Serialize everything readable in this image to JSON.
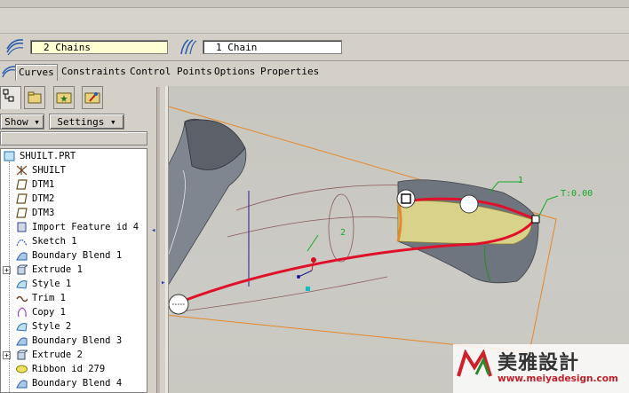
{
  "dashboard": {
    "chain_field_1": "2 Chains",
    "chain_field_2": "1 Chain"
  },
  "tabs": [
    "Curves",
    "Constraints",
    "Control Points",
    "Options",
    "Properties"
  ],
  "panel": {
    "show_label": "Show",
    "settings_label": "Settings"
  },
  "tree": [
    {
      "label": "SHUILT.PRT",
      "icon": "part-icon"
    },
    {
      "label": "SHUILT",
      "icon": "axes-icon"
    },
    {
      "label": "DTM1",
      "icon": "datum-plane-icon"
    },
    {
      "label": "DTM2",
      "icon": "datum-plane-icon"
    },
    {
      "label": "DTM3",
      "icon": "datum-plane-icon"
    },
    {
      "label": "Import Feature id 4",
      "icon": "import-icon"
    },
    {
      "label": "Sketch 1",
      "icon": "sketch-icon"
    },
    {
      "label": "Boundary Blend 1",
      "icon": "boundary-blend-icon"
    },
    {
      "label": "Extrude 1",
      "icon": "extrude-icon"
    },
    {
      "label": "Style 1",
      "icon": "style-icon"
    },
    {
      "label": "Trim 1",
      "icon": "trim-icon"
    },
    {
      "label": "Copy 1",
      "icon": "copy-icon"
    },
    {
      "label": "Style 2",
      "icon": "style-icon"
    },
    {
      "label": "Boundary Blend 3",
      "icon": "boundary-blend-icon"
    },
    {
      "label": "Extrude 2",
      "icon": "extrude-icon"
    },
    {
      "label": "Ribbon id 279",
      "icon": "ribbon-icon"
    },
    {
      "label": "Boundary Blend 4",
      "icon": "boundary-blend-icon"
    }
  ],
  "viewport": {
    "label_1": "1",
    "label_2": "2",
    "tension_label": "T:0.00"
  },
  "watermark": {
    "brand": "美雅設計",
    "url": "www.meiyadesign.com"
  },
  "colors": {
    "curve_red": "#e0102a",
    "surface_yellow": "#d9d28a",
    "boundary_orange": "#e6882a",
    "surface_grey": "#7d838c",
    "annotation_green": "#18a828"
  }
}
